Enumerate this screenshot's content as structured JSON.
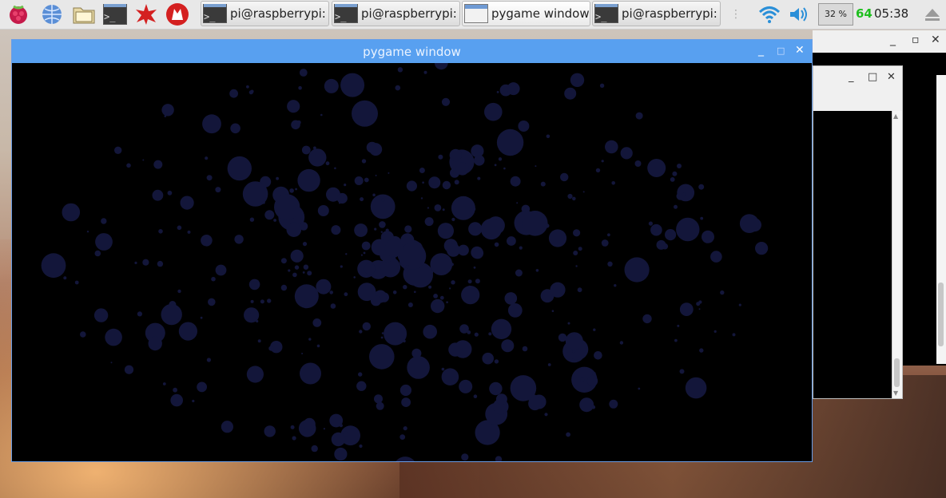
{
  "taskbar": {
    "launchers": [
      {
        "icon": "raspberry-icon"
      },
      {
        "icon": "web-browser-icon"
      },
      {
        "icon": "file-manager-icon"
      },
      {
        "icon": "terminal-icon"
      },
      {
        "icon": "mathematica-icon"
      },
      {
        "icon": "wolfram-icon"
      }
    ],
    "tasks": [
      {
        "label": "pi@raspberrypi: ...",
        "icon": "terminal-icon"
      },
      {
        "label": "pi@raspberrypi: ...",
        "icon": "terminal-icon"
      },
      {
        "label": "pygame window",
        "icon": "window-icon"
      },
      {
        "label": "pi@raspberrypi: ~",
        "icon": "terminal-icon"
      }
    ],
    "cpu_usage": "32 %",
    "temperature": "64",
    "clock": "05:38",
    "tray": {
      "wifi": "wifi-icon",
      "volume": "volume-icon",
      "eject": "eject-icon"
    }
  },
  "pygame_window": {
    "title": "pygame window",
    "bubble_color": "#13163a"
  },
  "colors": {
    "titlebar": "#58a0f0",
    "taskbar": "#e8e8e8",
    "temp_text": "#1fbf1f"
  }
}
